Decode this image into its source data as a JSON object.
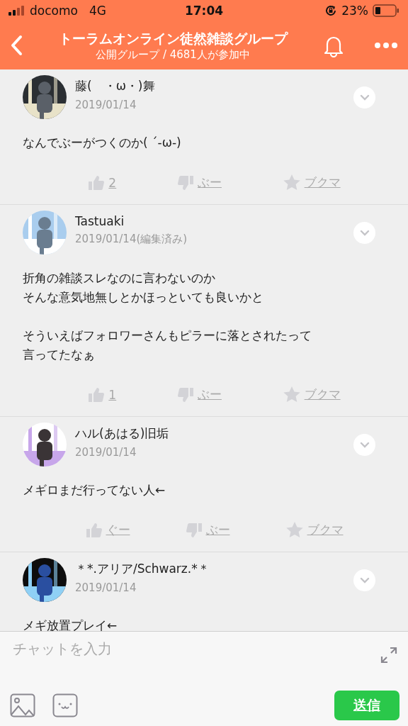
{
  "status_bar": {
    "carrier": "docomo",
    "network": "4G",
    "time": "17:04",
    "battery": "23%"
  },
  "header": {
    "title": "トーラムオンライン徒然雑談グループ",
    "subtitle": "公開グループ / 4681人が参加中"
  },
  "posts": [
    {
      "name": "藤(　・ω・)舞",
      "date": "2019/01/14",
      "body": [
        [
          "なんでぶーがつくのか( ´-ω-)"
        ]
      ],
      "actions": {
        "like": "2",
        "boo": "ぶー",
        "bookmark": "ブクマ"
      }
    },
    {
      "name": "Tastuaki",
      "date": "2019/01/14(編集済み)",
      "body": [
        [
          "折角の雑談スレなのに言わないのか",
          "そんな意気地無しとかほっといても良いかと"
        ],
        [
          "そういえばフォロワーさんもピラーに落とされたって",
          "言ってたなぁ"
        ]
      ],
      "actions": {
        "like": "1",
        "boo": "ぶー",
        "bookmark": "ブクマ"
      }
    },
    {
      "name": "ハル(あはる)旧垢",
      "date": "2019/01/14",
      "body": [
        [
          "メギロまだ行ってない人←"
        ]
      ],
      "actions": {
        "like": "ぐー",
        "boo": "ぶー",
        "bookmark": "ブクマ"
      }
    },
    {
      "name": "＊*.アリア/Schwarz.*＊",
      "date": "2019/01/14",
      "body": [
        [
          "メギ放置プレイ←"
        ]
      ]
    }
  ],
  "composer": {
    "placeholder": "チャットを入力",
    "send": "送信"
  }
}
